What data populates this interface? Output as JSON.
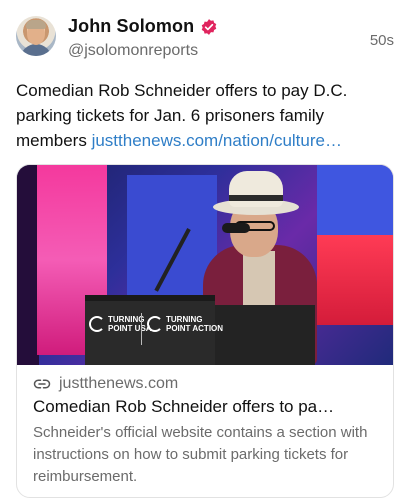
{
  "author": {
    "display_name": "John Solomon",
    "handle": "@jsolomonreports",
    "verified_badge_icon": "verified-badge-icon",
    "badge_color": "#e0245e"
  },
  "timestamp": "50s",
  "post": {
    "text": "Comedian Rob Schneider offers to pay D.C. parking tickets for Jan. 6 prisoners family members ",
    "link_text": "justthenews.com/nation/culture…",
    "link_color": "#2f7ec7"
  },
  "card": {
    "image_logos": [
      {
        "line1": "TURNING",
        "line2": "POINT USA"
      },
      {
        "line1": "TURNING",
        "line2": "POINT ACTION"
      }
    ],
    "link_icon": "link-icon",
    "domain": "justthenews.com",
    "title": "Comedian Rob Schneider offers to pa…",
    "description": "Schneider's official website contains a section with instructions on how to submit parking tickets for reimbursement."
  }
}
